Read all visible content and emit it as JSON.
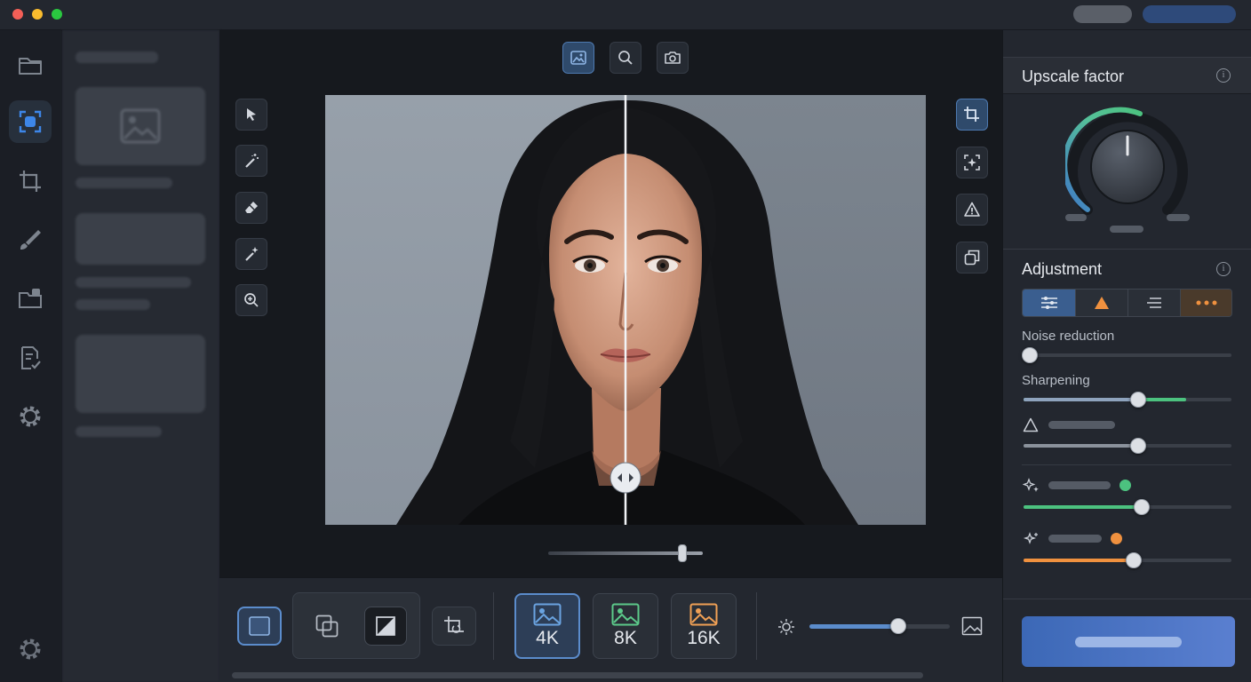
{
  "window": {
    "traffic_lights": [
      "#f35f57",
      "#f9bc2e",
      "#2ac840"
    ],
    "header_pills": [
      {
        "color": "#5a5f68"
      },
      {
        "color": "#2e4a7a"
      }
    ]
  },
  "rail": {
    "items": [
      {
        "name": "folder-icon",
        "active": false
      },
      {
        "name": "focus-select-icon",
        "active": true
      },
      {
        "name": "crop-icon",
        "active": false
      },
      {
        "name": "brush-icon",
        "active": false
      },
      {
        "name": "import-folder-icon",
        "active": false
      },
      {
        "name": "document-check-icon",
        "active": false
      },
      {
        "name": "gear-icon",
        "active": false
      },
      {
        "name": "settings-gear-icon",
        "active": false
      }
    ]
  },
  "canvas": {
    "top_tools": [
      "image-view-icon",
      "zoom-icon",
      "camera-icon"
    ],
    "left_tools": [
      "pointer-icon",
      "magic-wand-icon",
      "eraser-icon",
      "sparkle-wand-icon",
      "zoom-in-icon"
    ],
    "right_tools": [
      "crop-icon",
      "auto-enhance-icon",
      "warning-icon",
      "copy-icon"
    ],
    "compare_split": 0.5,
    "zoom_slider": 0.87
  },
  "bottom": {
    "resolutions": [
      {
        "label": "4K",
        "color": "#6aa3e0",
        "active": true
      },
      {
        "label": "8K",
        "color": "#5cc98a",
        "active": false
      },
      {
        "label": "16K",
        "color": "#f0a055",
        "active": false
      }
    ],
    "brightness_slider": 0.63
  },
  "panel": {
    "upscale": {
      "title": "Upscale factor",
      "info": "i",
      "dial_level": 0.55
    },
    "adjustment": {
      "title": "Adjustment",
      "info": "i",
      "tabs": [
        "sliders-icon",
        "triangle-icon",
        "list-icon",
        "more-icon"
      ],
      "sliders": [
        {
          "label": "Noise reduction",
          "value": 0.03
        },
        {
          "label": "Sharpening",
          "value": 0.55,
          "secondary": 0.78
        },
        {
          "icon": "warning-icon",
          "value": 0.55
        },
        {
          "icon": "sparkle-icon",
          "color": "#4cc27f",
          "value": 0.57
        },
        {
          "icon": "magic-icon",
          "color": "#f0913f",
          "value": 0.53
        }
      ]
    }
  },
  "colors": {
    "accent": "#4d79b0",
    "green": "#4cc27f",
    "orange": "#f0913f"
  }
}
